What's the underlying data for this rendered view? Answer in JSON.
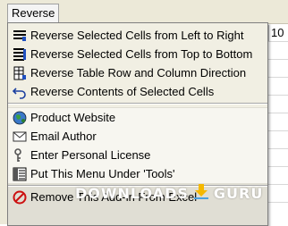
{
  "menubar": {
    "title": "Reverse"
  },
  "sheet": {
    "partial_cell": "10"
  },
  "menu": {
    "items": [
      {
        "label": "Reverse Selected Cells from Left to Right",
        "icon": "left-right-lines-icon"
      },
      {
        "label": "Reverse Selected Cells from Top to Bottom",
        "icon": "top-bottom-lines-icon"
      },
      {
        "label": "Reverse Table Row and Column Direction",
        "icon": "table-rotate-icon"
      },
      {
        "label": "Reverse Contents of Selected Cells",
        "icon": "undo-arrow-icon"
      },
      {
        "label": "Product Website",
        "icon": "globe-icon"
      },
      {
        "label": "Email Author",
        "icon": "email-icon"
      },
      {
        "label": "Enter Personal License",
        "icon": "key-icon"
      },
      {
        "label": "Put This Menu Under 'Tools'",
        "icon": "menu-grid-icon"
      },
      {
        "label": "Remove This Add-in From Excel",
        "icon": "remove-circle-icon"
      }
    ]
  },
  "watermark": {
    "left": "DOWNLOADS",
    "right": "GURU",
    "color": "#ffffff"
  }
}
